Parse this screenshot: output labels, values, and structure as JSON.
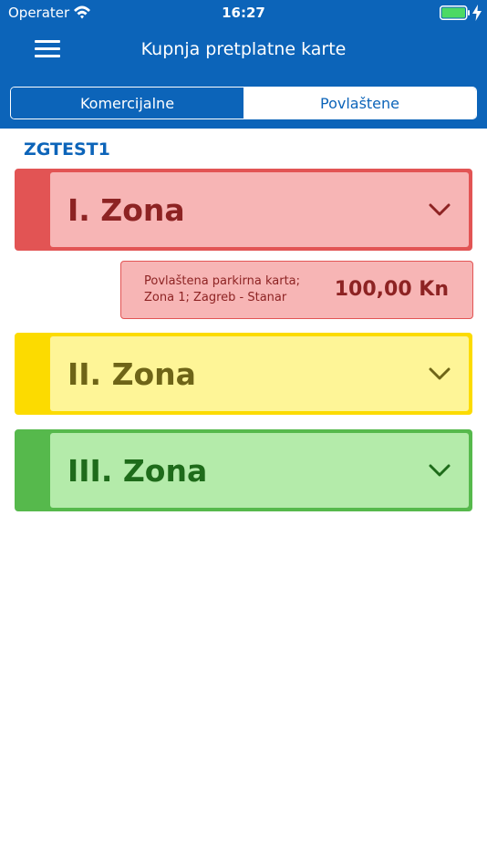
{
  "status_bar": {
    "carrier": "Operater",
    "time": "16:27",
    "wifi_icon": "wifi-icon",
    "battery_icon": "battery-icon",
    "charging_icon": "lightning-bolt-icon"
  },
  "nav": {
    "title": "Kupnja pretplatne karte",
    "menu_icon": "hamburger-menu-icon"
  },
  "tabs": [
    {
      "label": "Komercijalne",
      "selected": true
    },
    {
      "label": "Povlaštene",
      "selected": false
    }
  ],
  "section_title": "ZGTEST1",
  "zones": [
    {
      "label": "I. Zona",
      "expanded": true,
      "accent": "#e25454",
      "fill": "#f7b5b5",
      "text_color": "#8d2323",
      "icon": "chevron-down-icon"
    },
    {
      "label": "II. Zona",
      "expanded": false,
      "accent": "#fcdb00",
      "fill": "#fef597",
      "text_color": "#6e6417",
      "icon": "chevron-down-icon"
    },
    {
      "label": "III. Zona",
      "expanded": false,
      "accent": "#56b94c",
      "fill": "#b4ebaa",
      "text_color": "#1e6b1a",
      "icon": "chevron-down-icon"
    }
  ],
  "ticket": {
    "line1": "Povlaštena parkirna karta;",
    "line2": "Zona 1; Zagreb - Stanar",
    "price": "100,00 Kn"
  },
  "colors": {
    "brand_blue": "#0c64b9",
    "white": "#ffffff"
  }
}
